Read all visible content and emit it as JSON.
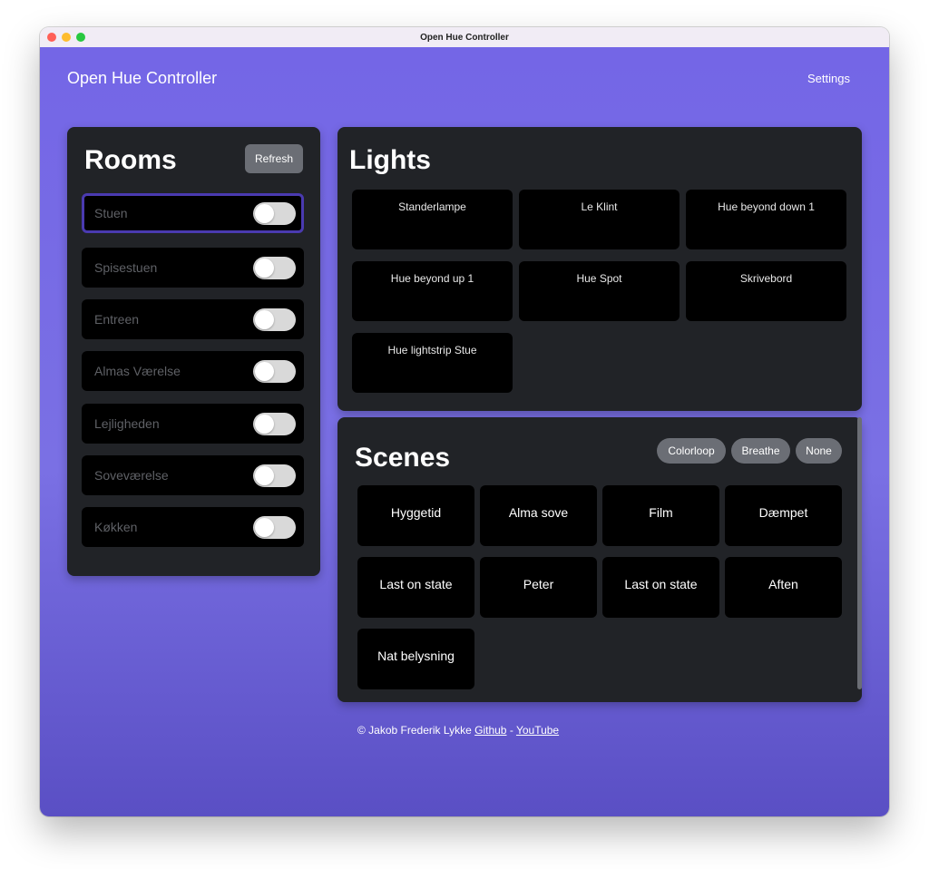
{
  "window": {
    "title": "Open Hue Controller"
  },
  "header": {
    "app_title": "Open Hue Controller",
    "settings_label": "Settings"
  },
  "rooms": {
    "heading": "Rooms",
    "refresh_label": "Refresh",
    "items": [
      {
        "label": "Stuen",
        "on": false,
        "selected": true
      },
      {
        "label": "Spisestuen",
        "on": false
      },
      {
        "label": "Entreen",
        "on": false
      },
      {
        "label": "Almas Værelse",
        "on": false
      },
      {
        "label": "Lejligheden",
        "on": false
      },
      {
        "label": "Soveværelse",
        "on": false
      },
      {
        "label": "Køkken",
        "on": false
      }
    ]
  },
  "lights": {
    "heading": "Lights",
    "items": [
      {
        "label": "Standerlampe"
      },
      {
        "label": "Le Klint"
      },
      {
        "label": "Hue beyond down 1"
      },
      {
        "label": "Hue beyond up 1"
      },
      {
        "label": "Hue Spot"
      },
      {
        "label": "Skrivebord"
      },
      {
        "label": "Hue lightstrip Stue"
      }
    ]
  },
  "scenes": {
    "heading": "Scenes",
    "effects": [
      "Colorloop",
      "Breathe",
      "None"
    ],
    "items": [
      {
        "label": "Hyggetid"
      },
      {
        "label": "Alma sove"
      },
      {
        "label": "Film"
      },
      {
        "label": "Dæmpet"
      },
      {
        "label": "Last on state"
      },
      {
        "label": "Peter"
      },
      {
        "label": "Last on state"
      },
      {
        "label": "Aften"
      },
      {
        "label": "Nat belysning"
      }
    ]
  },
  "footer": {
    "copyright": "© Jakob Frederik Lykke",
    "github_label": "Github",
    "separator": "-",
    "youtube_label": "YouTube"
  },
  "colors": {
    "background_top": "#7466e6",
    "background_bottom": "#5a4fc4",
    "card": "#212327",
    "tile": "#000000",
    "pill": "#6b6e75",
    "selected_border": "#4a3ab0"
  }
}
